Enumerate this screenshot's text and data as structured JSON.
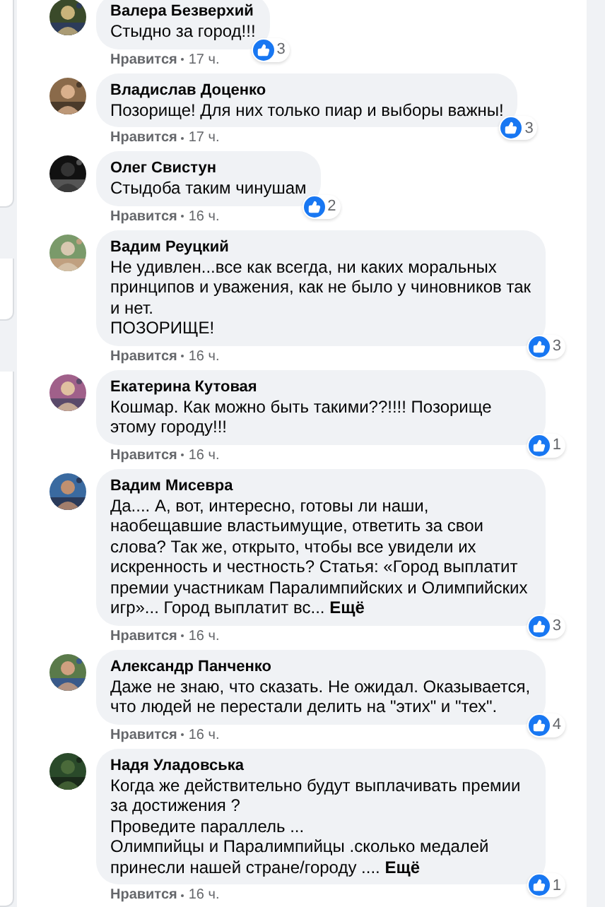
{
  "comments": [
    {
      "author": "Валера Безверхий",
      "text": "Стыдно за город!!!",
      "like": "Нравится",
      "time": "17 ч.",
      "reactions": "3"
    },
    {
      "author": "Владислав Доценко",
      "text": "Позорище! Для них только пиар и выборы важны!",
      "like": "Нравится",
      "time": "17 ч.",
      "reactions": "3"
    },
    {
      "author": "Олег Свистун",
      "text": "Стыдоба таким чинушам",
      "like": "Нравится",
      "time": "16 ч.",
      "reactions": "2"
    },
    {
      "author": "Вадим Реуцкий",
      "text": "Не удивлен...все как всегда, ни каких моральных принципов и уважения, как не было у чиновников так и нет.\nПОЗОРИЩЕ!",
      "like": "Нравится",
      "time": "16 ч.",
      "reactions": "3"
    },
    {
      "author": "Екатерина Кутовая",
      "text": "Кошмар. Как можно быть такими??!!!! Позорище этому городу!!!",
      "like": "Нравится",
      "time": "16 ч.",
      "reactions": "1"
    },
    {
      "author": "Вадим Мисевра",
      "text": "Да.... А, вот, интересно, готовы ли наши, наобещавшие властьимущие, ответить за свои слова? Так же, открыто, чтобы все увидели их искренность и честность? Статья: «Город выплатит премии участникам Паралимпийских и Олимпийских игр»... Город выплатит вс...",
      "more": "Ещё",
      "like": "Нравится",
      "time": "16 ч.",
      "reactions": "3"
    },
    {
      "author": "Александр Панченко",
      "text": "Даже не знаю, что сказать. Не ожидал. Оказывается, что людей не перестали делить на \"этих\" и \"тех\".",
      "like": "Нравится",
      "time": "16 ч.",
      "reactions": "4"
    },
    {
      "author": "Надя Уладовська",
      "text": "Когда же действительно будут выплачивать премии за достижения ?\nПроведите параллель ...\nОлимпийцы и Паралимпийцы .сколько медалей принесли нашей стране/городу ....",
      "more": "Ещё",
      "like": "Нравится",
      "time": "16 ч.",
      "reactions": "1"
    }
  ]
}
